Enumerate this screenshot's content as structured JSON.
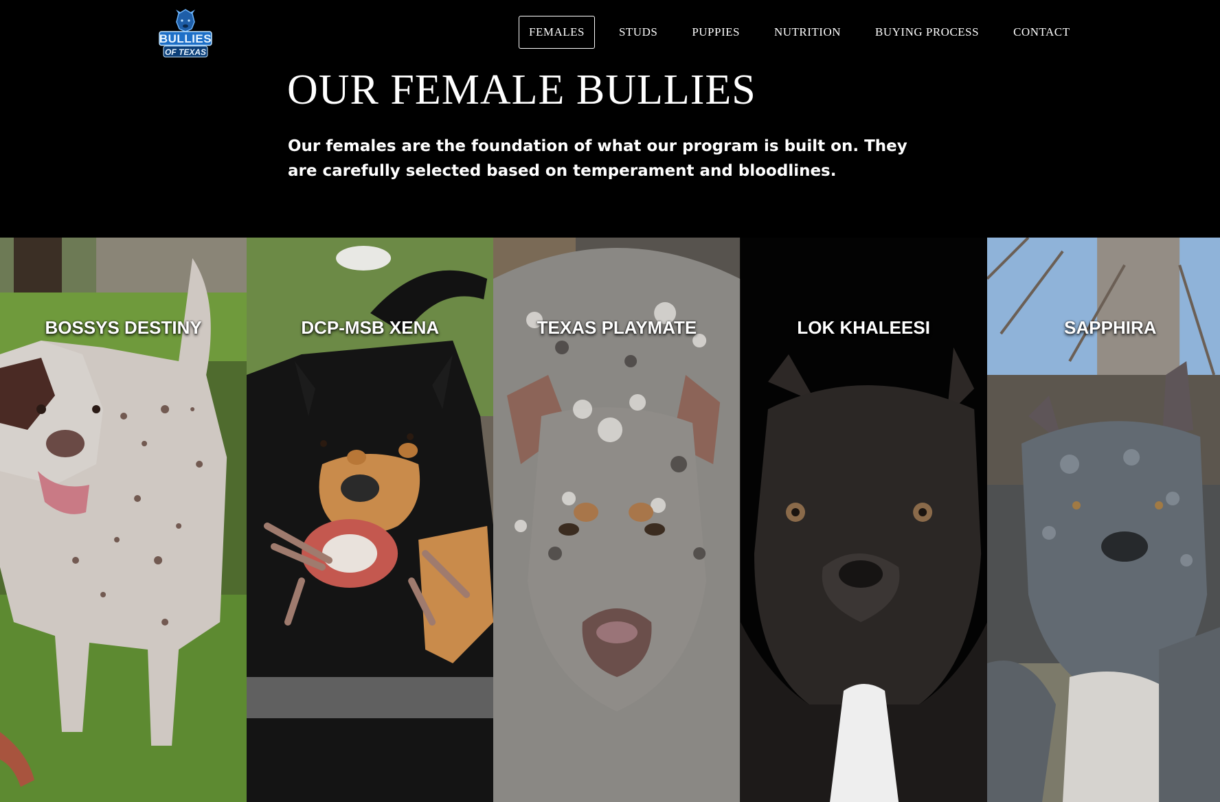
{
  "site": {
    "logo": {
      "icon": "bully-dog-shield-icon",
      "line1": "BULLIES",
      "line2": "OF TEXAS",
      "color": "#3a8fe0"
    }
  },
  "nav": {
    "items": [
      {
        "label": "FEMALES",
        "active": true
      },
      {
        "label": "STUDS"
      },
      {
        "label": "PUPPIES"
      },
      {
        "label": "NUTRITION"
      },
      {
        "label": "BUYING PROCESS"
      },
      {
        "label": "CONTACT"
      }
    ]
  },
  "hero": {
    "title": "OUR FEMALE BULLIES",
    "intro": "Our females are the foundation of what our program is built on. They are carefully selected based on temperament and bloodlines."
  },
  "females": [
    {
      "name": "BOSSYS DESTINY",
      "photo": "merle-white-bully-in-yard-photo"
    },
    {
      "name": "DCP-MSB XENA",
      "photo": "black-tan-bully-with-rope-toy-photo"
    },
    {
      "name": "TEXAS PLAYMATE",
      "photo": "merle-bully-closeup-photo"
    },
    {
      "name": "LOK KHALEESI",
      "photo": "black-bully-portrait-photo"
    },
    {
      "name": "SAPPHIRA",
      "photo": "blue-merle-bully-outdoor-photo"
    }
  ],
  "colors": {
    "background": "#000000",
    "text": "#ffffff"
  }
}
